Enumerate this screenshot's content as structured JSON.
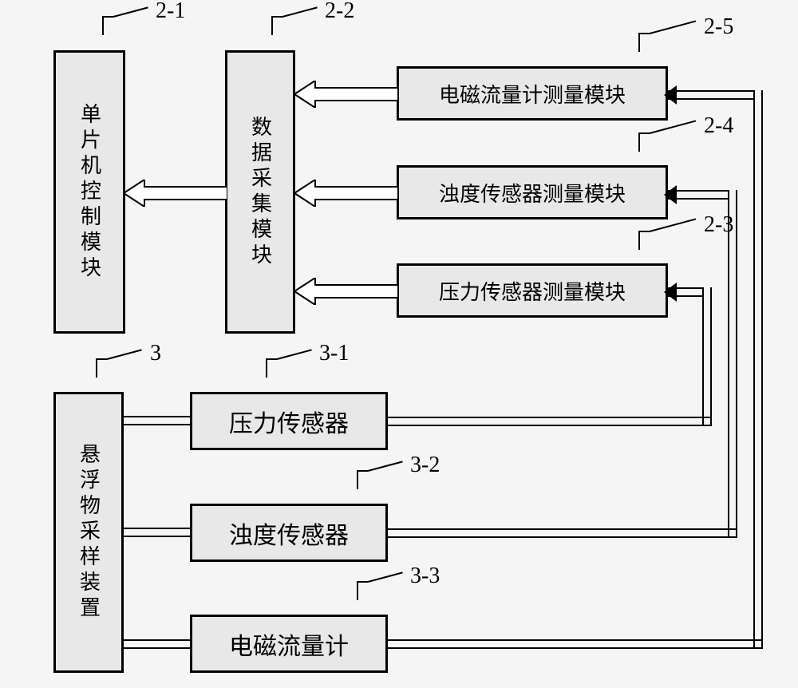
{
  "labels": {
    "l21": "2-1",
    "l22": "2-2",
    "l25": "2-5",
    "l24": "2-4",
    "l23": "2-3",
    "l3": "3",
    "l31": "3-1",
    "l32": "3-2",
    "l33": "3-3"
  },
  "boxes": {
    "b21": "单片机控制模块",
    "b22": "数据采集模块",
    "b25": "电磁流量计测量模块",
    "b24": "浊度传感器测量模块",
    "b23": "压力传感器测量模块",
    "b3": "悬浮物采样装置",
    "b31": "压力传感器",
    "b32": "浊度传感器",
    "b33": "电磁流量计"
  }
}
